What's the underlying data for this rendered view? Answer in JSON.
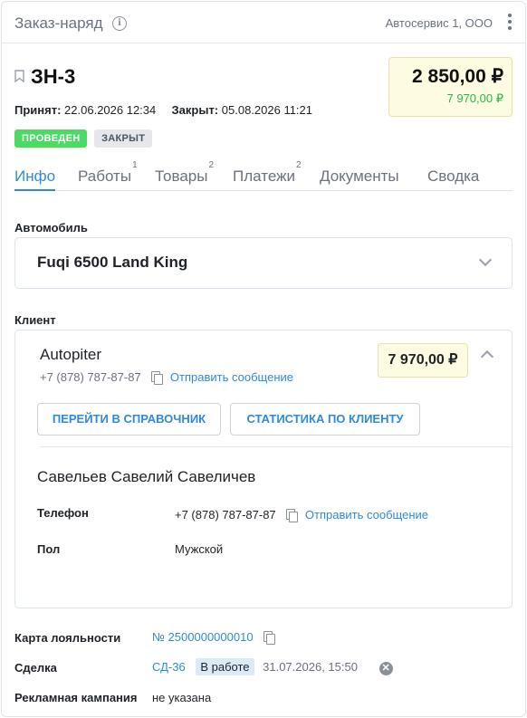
{
  "header": {
    "title": "Заказ-наряд",
    "company": "Автосервис 1, ООО"
  },
  "order": {
    "number": "ЗН-3",
    "accepted_label": "Принят:",
    "accepted_value": "22.06.2026 12:34",
    "closed_label": "Закрыт:",
    "closed_value": "05.08.2026 11:21",
    "badges": [
      "ПРОВЕДЕН",
      "ЗАКРЫТ"
    ],
    "total": "2 850,00 ₽",
    "paid": "7 970,00 ₽"
  },
  "tabs": [
    {
      "label": "Инфо",
      "count": ""
    },
    {
      "label": "Работы",
      "count": "1"
    },
    {
      "label": "Товары",
      "count": "2"
    },
    {
      "label": "Платежи",
      "count": "2"
    },
    {
      "label": "Документы",
      "count": ""
    },
    {
      "label": "Сводка",
      "count": ""
    }
  ],
  "car": {
    "label": "Автомобиль",
    "name": "Fuqi 6500 Land King"
  },
  "client": {
    "label": "Клиент",
    "name": "Autopiter",
    "phone": "+7 (878) 787-87-87",
    "send_message": "Отправить сообщение",
    "balance": "7 970,00 ₽",
    "btn_directory": "ПЕРЕЙТИ В СПРАВОЧНИК",
    "btn_stats": "СТАТИСТИКА ПО КЛИЕНТУ",
    "contact": {
      "name": "Савельев Савелий Савеличев",
      "phone_label": "Телефон",
      "phone": "+7 (878) 787-87-87",
      "send_message": "Отправить сообщение",
      "gender_label": "Пол",
      "gender": "Мужской"
    }
  },
  "loyalty": {
    "label": "Карта лояльности",
    "value": "№ 2500000000010"
  },
  "deal": {
    "label": "Сделка",
    "id": "СД-36",
    "status": "В работе",
    "date": "31.07.2026, 15:50"
  },
  "campaign": {
    "label": "Рекламная кампания",
    "value": "не указана"
  },
  "colors": {
    "accent": "#2f8bd8",
    "success": "#4cd964",
    "paid": "#22b94b",
    "highlight_bg": "#fefbe3"
  }
}
